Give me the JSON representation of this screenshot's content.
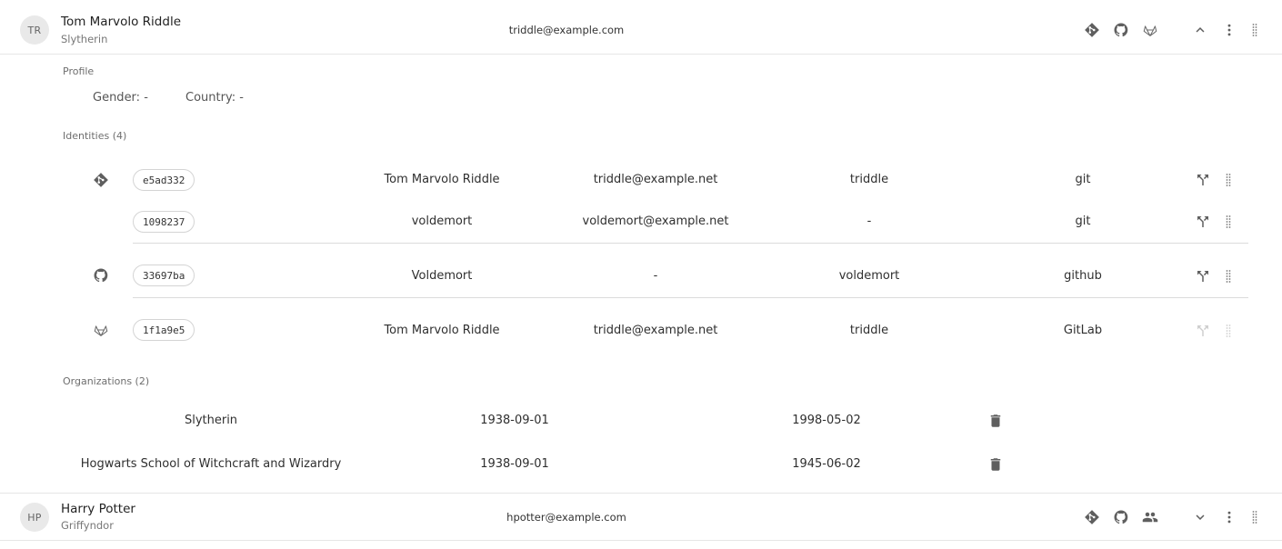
{
  "individuals": [
    {
      "initials": "TR",
      "name": "Tom Marvolo Riddle",
      "enrollment": "Slytherin",
      "email": "triddle@example.com",
      "source_icons": [
        "git-icon",
        "github-icon",
        "gitlab-icon"
      ],
      "expanded": true,
      "profile": {
        "label": "Profile",
        "gender": "Gender: -",
        "country": "Country: -"
      },
      "identities": {
        "label": "Identities (4)",
        "rows": [
          {
            "source_icon": "git-icon",
            "uuid": "e5ad332",
            "name": "Tom Marvolo Riddle",
            "email": "triddle@example.net",
            "username": "triddle",
            "source": "git",
            "split_enabled": true
          },
          {
            "source_icon": "",
            "uuid": "1098237",
            "name": "voldemort",
            "email": "voldemort@example.net",
            "username": "-",
            "source": "git",
            "split_enabled": true
          },
          {
            "source_icon": "github-icon",
            "uuid": "33697ba",
            "name": "Voldemort",
            "email": "-",
            "username": "voldemort",
            "source": "github",
            "split_enabled": true
          },
          {
            "source_icon": "gitlab-icon",
            "uuid": "1f1a9e5",
            "name": "Tom Marvolo Riddle",
            "email": "triddle@example.net",
            "username": "triddle",
            "source": "GitLab",
            "split_enabled": false
          }
        ]
      },
      "organizations": {
        "label": "Organizations (2)",
        "rows": [
          {
            "name": "Slytherin",
            "from": "1938-09-01",
            "to": "1998-05-02"
          },
          {
            "name": "Hogwarts School of Witchcraft and Wizardry",
            "from": "1938-09-01",
            "to": "1945-06-02"
          }
        ]
      }
    },
    {
      "initials": "HP",
      "name": "Harry Potter",
      "enrollment": "Griffyndor",
      "email": "hpotter@example.com",
      "source_icons": [
        "git-icon",
        "github-icon",
        "people-icon"
      ],
      "expanded": false
    }
  ],
  "colors": {
    "icon": "#5f5f5f",
    "icon_disabled": "#cfcfcf",
    "divider": "#e6e6e6"
  }
}
